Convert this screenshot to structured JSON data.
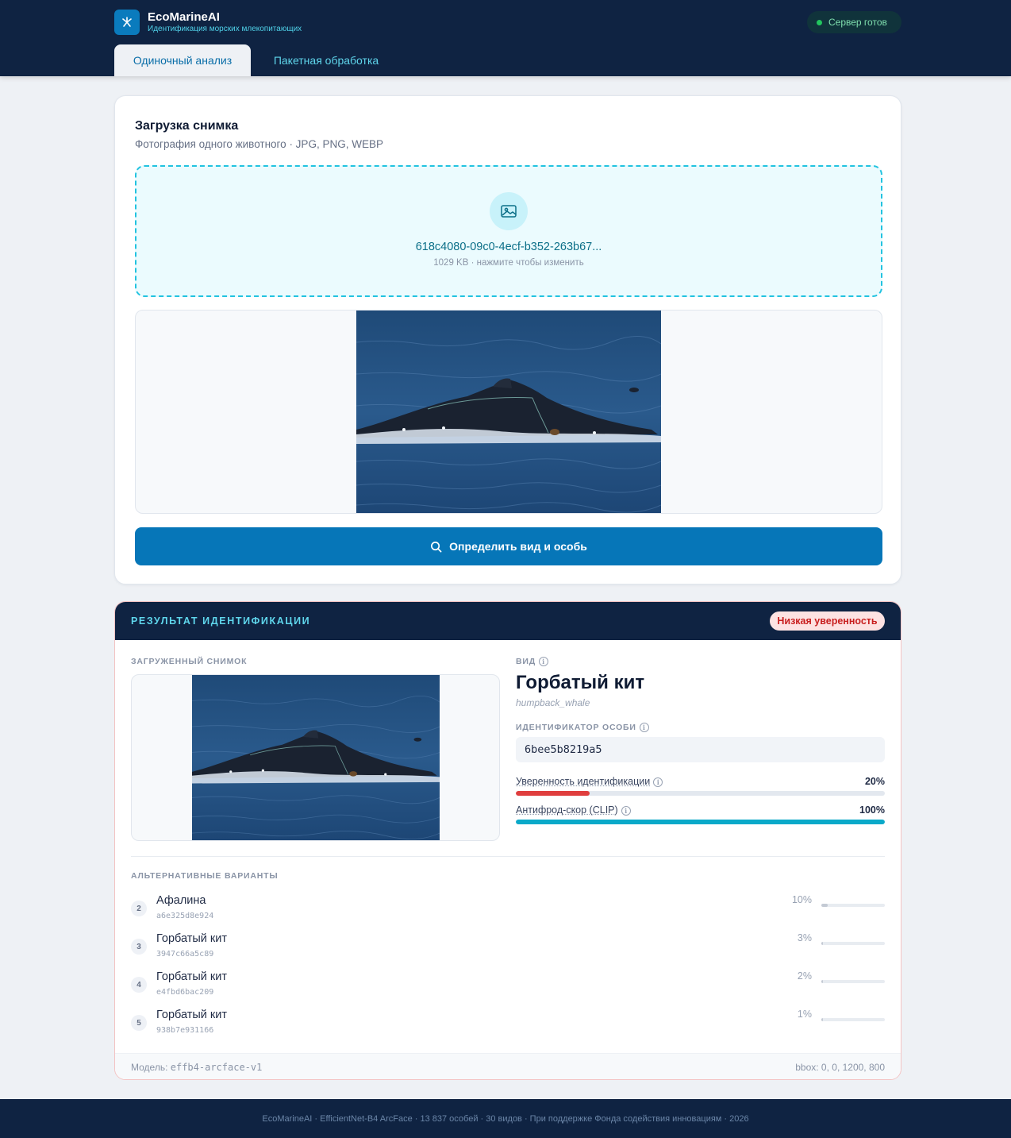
{
  "header": {
    "brand_title": "EcoMarineAI",
    "brand_subtitle": "Идентификация морских млекопитающих",
    "server_status": "Сервер готов",
    "tabs": [
      {
        "label": "Одиночный анализ",
        "active": true
      },
      {
        "label": "Пакетная обработка",
        "active": false
      }
    ]
  },
  "upload": {
    "title": "Загрузка снимка",
    "subtitle": "Фотография одного животного · JPG, PNG, WEBP",
    "file_name": "618c4080-09c0-4ecf-b352-263b67...",
    "file_meta": "1029 KB · нажмите чтобы изменить",
    "analyze_button": "Определить вид и особь"
  },
  "result": {
    "title": "РЕЗУЛЬТАТ ИДЕНТИФИКАЦИИ",
    "confidence_badge": "Низкая уверенность",
    "image_label": "ЗАГРУЖЕННЫЙ СНИМОК",
    "species_label": "ВИД",
    "species_name": "Горбатый кит",
    "species_latin": "humpback_whale",
    "individual_label": "ИДЕНТИФИКАТОР ОСОБИ",
    "individual_id": "6bee5b8219a5",
    "metrics": [
      {
        "label": "Уверенность идентификации",
        "value_text": "20%",
        "value": 0.2,
        "color": "#e03e3e"
      },
      {
        "label": "Антифрод-скор (CLIP)",
        "value_text": "100%",
        "value": 1.0,
        "color": "#0aa9c9"
      }
    ],
    "alternatives_label": "АЛЬТЕРНАТИВНЫЕ ВАРИАНТЫ",
    "alternatives": [
      {
        "rank": "2",
        "name": "Афалина",
        "id": "a6e325d8e924",
        "pct_text": "10%",
        "value": 0.1
      },
      {
        "rank": "3",
        "name": "Горбатый кит",
        "id": "3947c66a5c89",
        "pct_text": "3%",
        "value": 0.03
      },
      {
        "rank": "4",
        "name": "Горбатый кит",
        "id": "e4fbd6bac209",
        "pct_text": "2%",
        "value": 0.02
      },
      {
        "rank": "5",
        "name": "Горбатый кит",
        "id": "938b7e931166",
        "pct_text": "1%",
        "value": 0.01
      }
    ],
    "model_prefix": "Модель:",
    "model_name": "effb4-arcface-v1",
    "bbox_text": "bbox: 0, 0, 1200, 800"
  },
  "footer": {
    "text": "EcoMarineAI · EfficientNet-B4 ArcFace · 13 837 особей · 30 видов · При поддержке Фонда содействия инновациям · 2026"
  },
  "colors": {
    "accent": "#0676b8",
    "navy": "#0f2342",
    "cyan": "#22c3e0",
    "danger": "#e03e3e"
  }
}
